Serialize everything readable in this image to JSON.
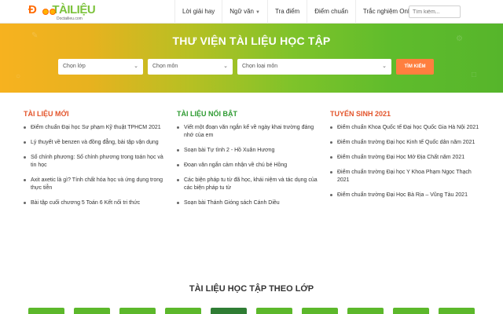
{
  "brand": {
    "logo_text_a": "Đ",
    "logo_text_b": "TÀILIỆU",
    "logo_sub": "Doctailieu.com"
  },
  "nav": {
    "items": [
      "Lời giải hay",
      "Ngữ văn",
      "Tra điểm",
      "Điểm chuẩn",
      "Trắc nghiệm Online"
    ],
    "search_placeholder": "Tìm kiếm..."
  },
  "hero": {
    "title": "THƯ VIỆN TÀI LIỆU HỌC TẬP",
    "select_class": "Chọn lớp",
    "select_subject": "Chọn môn",
    "select_type": "Chọn loại môn",
    "search_button": "TÌM KIẾM"
  },
  "columns": [
    {
      "title": "TÀI LIỆU MỚI",
      "items": [
        "Điểm chuẩn Đại học Sư phạm Kỹ thuật TPHCM 2021",
        "Lý thuyết về benzen và đồng đẳng, bài tập vận dụng",
        "Số chính phương: Số chính phương trong toán học và tin học",
        "Axit axetic là gì? Tính chất hóa học và ứng dụng trong thực tiễn",
        "Bài tập cuối chương 5 Toán 6 Kết nối tri thức"
      ]
    },
    {
      "title": "TÀI LIỆU NỔI BẬT",
      "items": [
        "Viết một đoạn văn ngắn kể về ngày khai trường đáng nhớ của em",
        "Soạn bài Tự tình 2 - Hồ Xuân Hương",
        "Đoạn văn ngắn cảm nhận về chú bé Hồng",
        "Các biện pháp tu từ đã học, khái niệm và tác dụng của các biện pháp tu từ",
        "Soạn bài Thánh Gióng sách Cánh Diều"
      ]
    },
    {
      "title": "TUYỂN SINH 2021",
      "items": [
        "Điểm chuẩn Khoa Quốc tế Đại học Quốc Gia Hà Nội 2021",
        "Điểm chuẩn trường Đại học Kinh tế Quốc dân năm 2021",
        "Điểm chuẩn trường Đại Học Mở Địa Chất năm 2021",
        "Điểm chuẩn trường Đại học Y Khoa Phạm Ngọc Thạch 2021",
        "Điểm chuẩn trường Đại Học Bà Rịa – Vũng Tàu 2021"
      ]
    }
  ],
  "bottom": {
    "title": "TÀI LIỆU HỌC TẬP THEO LỚP"
  },
  "colors": {
    "accent_orange": "#ff7f3f",
    "title_red": "#e3542b",
    "title_green": "#2d9a31",
    "brand_green": "#5cb82b"
  }
}
